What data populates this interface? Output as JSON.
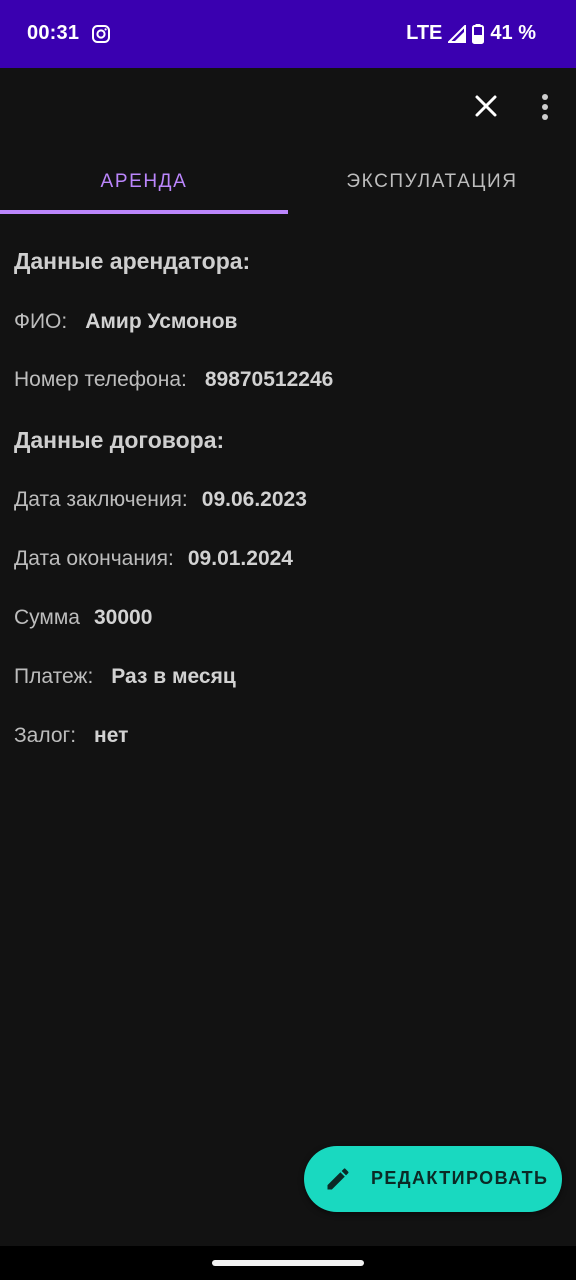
{
  "status_bar": {
    "time": "00:31",
    "network": "LTE",
    "battery": "41 %",
    "bg_color": "#3a00b0"
  },
  "icons": {
    "status_app": "instagram-icon",
    "close": "close-icon",
    "more": "more-vert-icon",
    "edit": "pencil-icon"
  },
  "tabs": [
    {
      "label": "АРЕНДА",
      "selected": true
    },
    {
      "label": "ЭКСПУЛАТАЦИЯ",
      "selected": false
    }
  ],
  "tenant": {
    "title": "Данные арендатора:",
    "name_label": "ФИО:",
    "name_value": "Амир Усмонов",
    "phone_label": "Номер телефона:",
    "phone_value": "89870512246"
  },
  "contract": {
    "title": "Данные договора:",
    "start_label": "Дата заключения:",
    "start_value": "09.06.2023",
    "end_label": "Дата окончания:",
    "end_value": "09.01.2024",
    "sum_label": "Сумма",
    "sum_value": "30000",
    "payment_label": "Платеж:",
    "payment_value": "Раз в месяц",
    "deposit_label": "Залог:",
    "deposit_value": "нет"
  },
  "fab": {
    "label": "РЕДАКТИРОВАТЬ",
    "color": "#19d9c0"
  },
  "accent_color": "#bb86fc"
}
